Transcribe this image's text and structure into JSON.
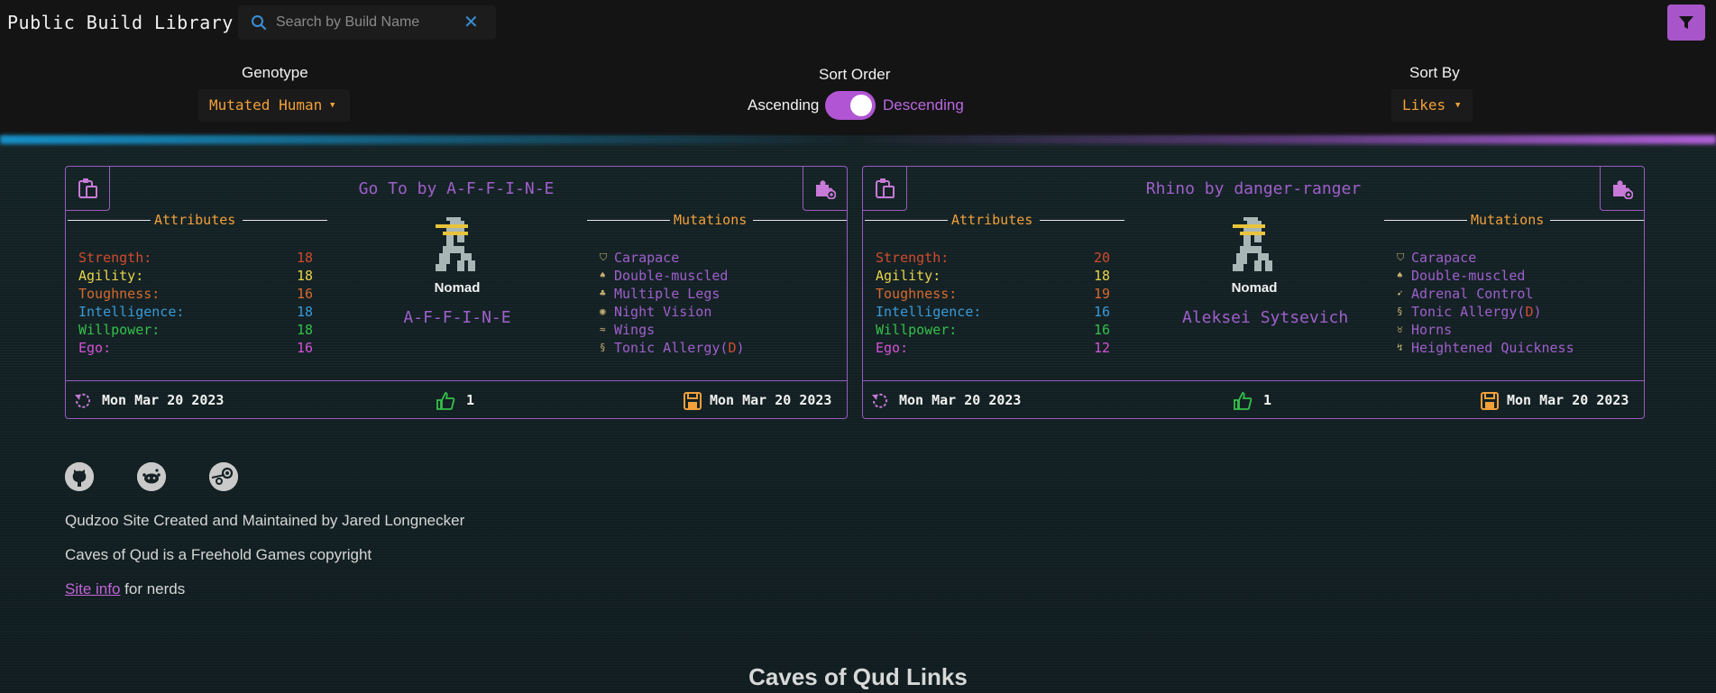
{
  "header": {
    "title": "Public Build Library",
    "search_placeholder": "Search by Build Name"
  },
  "controls": {
    "genotype_label": "Genotype",
    "genotype_value": "Mutated Human",
    "sort_order_label": "Sort Order",
    "sort_ascending": "Ascending",
    "sort_descending": "Descending",
    "sort_by_label": "Sort By",
    "sort_by_value": "Likes"
  },
  "colors": {
    "accent": "#a855c9",
    "orange": "#f1a03a",
    "strength": "#d24b2d",
    "agility": "#e8d44a",
    "toughness": "#d76a2e",
    "intelligence": "#3a9ad8",
    "willpower": "#34c04a",
    "ego": "#d552d8"
  },
  "builds": [
    {
      "title": "Go To by A-F-F-I-N-E",
      "attributes_header": "Attributes",
      "mutations_header": "Mutations",
      "attributes": [
        {
          "name": "Strength:",
          "value": "18"
        },
        {
          "name": "Agility:",
          "value": "18"
        },
        {
          "name": "Toughness:",
          "value": "16"
        },
        {
          "name": "Intelligence:",
          "value": "18"
        },
        {
          "name": "Willpower:",
          "value": "18"
        },
        {
          "name": "Ego:",
          "value": "16"
        }
      ],
      "class": "Nomad",
      "author": "A-F-F-I-N-E",
      "mutations": [
        {
          "name": "Carapace",
          "icon": "shell-icon"
        },
        {
          "name": "Double-muscled",
          "icon": "arm-icon"
        },
        {
          "name": "Multiple Legs",
          "icon": "legs-icon"
        },
        {
          "name": "Night Vision",
          "icon": "eye-icon"
        },
        {
          "name": "Wings",
          "icon": "wing-icon"
        },
        {
          "name": "Tonic Allergy",
          "icon": "allergy-icon",
          "defect": "D"
        }
      ],
      "created": "Mon Mar 20 2023",
      "likes": "1",
      "updated": "Mon Mar 20 2023"
    },
    {
      "title": "Rhino by danger-ranger",
      "attributes_header": "Attributes",
      "mutations_header": "Mutations",
      "attributes": [
        {
          "name": "Strength:",
          "value": "20"
        },
        {
          "name": "Agility:",
          "value": "18"
        },
        {
          "name": "Toughness:",
          "value": "19"
        },
        {
          "name": "Intelligence:",
          "value": "16"
        },
        {
          "name": "Willpower:",
          "value": "16"
        },
        {
          "name": "Ego:",
          "value": "12"
        }
      ],
      "class": "Nomad",
      "author": "Aleksei Sytsevich",
      "mutations": [
        {
          "name": "Carapace",
          "icon": "shell-icon"
        },
        {
          "name": "Double-muscled",
          "icon": "arm-icon"
        },
        {
          "name": "Adrenal Control",
          "icon": "adrenal-icon"
        },
        {
          "name": "Tonic Allergy",
          "icon": "allergy-icon",
          "defect": "D"
        },
        {
          "name": "Horns",
          "icon": "horns-icon"
        },
        {
          "name": "Heightened Quickness",
          "icon": "quickness-icon"
        }
      ],
      "created": "Mon Mar 20 2023",
      "likes": "1",
      "updated": "Mon Mar 20 2023"
    }
  ],
  "footer": {
    "credit": "Qudzoo Site Created and Maintained by Jared Longnecker",
    "copyright": "Caves of Qud is a Freehold Games copyright",
    "site_info_link": "Site info",
    "site_info_suffix": " for nerds",
    "links_heading": "Caves of Qud Links"
  }
}
